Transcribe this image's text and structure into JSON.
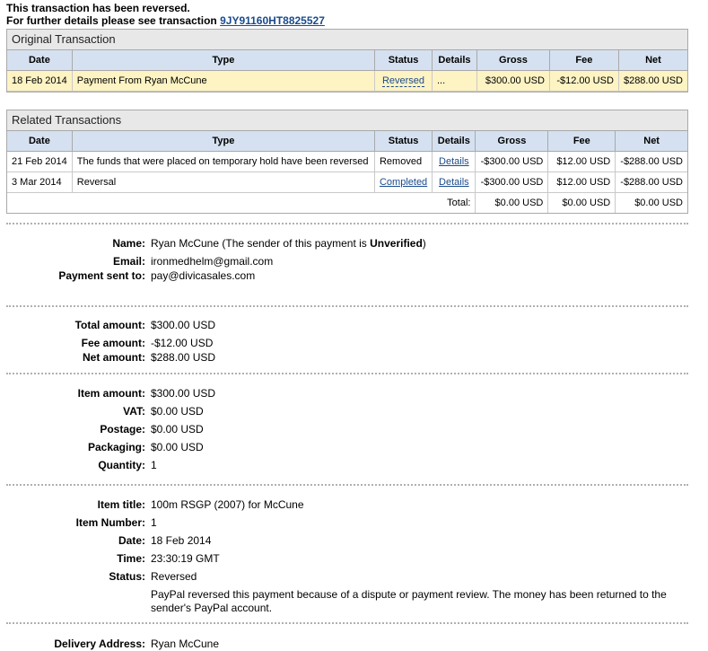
{
  "notice": {
    "line1": "This transaction has been reversed.",
    "line2": "For further details please see transaction",
    "txn_link": "9JY91160HT8825527"
  },
  "original": {
    "title": "Original Transaction",
    "headers": [
      "Date",
      "Type",
      "Status",
      "Details",
      "Gross",
      "Fee",
      "Net"
    ],
    "row": {
      "date": "18 Feb 2014",
      "type": "Payment From Ryan McCune",
      "status": "Reversed",
      "details": "...",
      "gross": "$300.00 USD",
      "fee": "-$12.00 USD",
      "net": "$288.00 USD"
    }
  },
  "related": {
    "title": "Related Transactions",
    "headers": [
      "Date",
      "Type",
      "Status",
      "Details",
      "Gross",
      "Fee",
      "Net"
    ],
    "rows": [
      {
        "date": "21 Feb 2014",
        "type": "The funds that were placed on temporary hold have been reversed",
        "status": "Removed",
        "details": "Details",
        "gross": "-$300.00 USD",
        "fee": "$12.00 USD",
        "net": "-$288.00 USD"
      },
      {
        "date": "3 Mar 2014",
        "type": "Reversal",
        "status": "Completed",
        "details": "Details",
        "gross": "-$300.00 USD",
        "fee": "$12.00 USD",
        "net": "-$288.00 USD"
      }
    ],
    "total_label": "Total:",
    "total": {
      "gross": "$0.00 USD",
      "fee": "$0.00 USD",
      "net": "$0.00 USD"
    }
  },
  "party": {
    "name_label": "Name:",
    "name": "Ryan McCune",
    "name_note_pre": " (The sender of this payment is ",
    "name_note_bold": "Unverified",
    "name_note_post": ")",
    "email_label": "Email:",
    "email": "ironmedhelm@gmail.com",
    "sent_to_label": "Payment sent to:",
    "sent_to": "pay@divicasales.com"
  },
  "amounts": {
    "total_label": "Total amount:",
    "total": "$300.00 USD",
    "fee_label": "Fee amount:",
    "fee": "-$12.00 USD",
    "net_label": "Net amount:",
    "net": "$288.00 USD"
  },
  "item_costs": {
    "item_amount_label": "Item amount:",
    "item_amount": "$300.00 USD",
    "vat_label": "VAT:",
    "vat": "$0.00 USD",
    "postage_label": "Postage:",
    "postage": "$0.00 USD",
    "packaging_label": "Packaging:",
    "packaging": "$0.00 USD",
    "quantity_label": "Quantity:",
    "quantity": "1"
  },
  "item_info": {
    "title_label": "Item title:",
    "title": "100m RSGP (2007) for McCune",
    "number_label": "Item Number:",
    "number": "1",
    "date_label": "Date:",
    "date": "18 Feb 2014",
    "time_label": "Time:",
    "time": "23:30:19 GMT",
    "status_label": "Status:",
    "status": "Reversed",
    "status_note": "PayPal reversed this payment because of a dispute or payment review. The money has been returned to the sender's PayPal account."
  },
  "delivery": {
    "label": "Delivery Address:",
    "name": "Ryan McCune"
  }
}
